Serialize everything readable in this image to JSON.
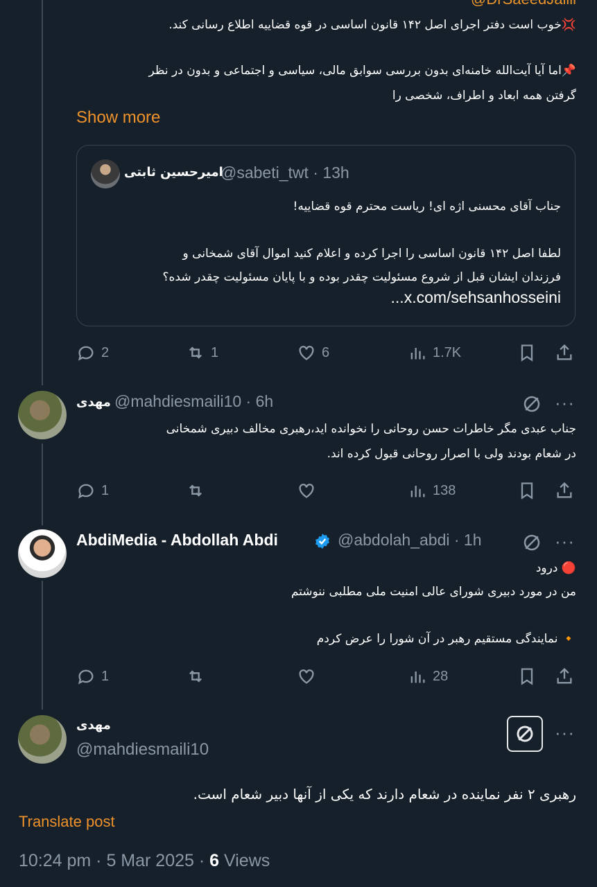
{
  "top": {
    "handle_partial": "@DrSaeedJalili",
    "line1": "💢خوب است دفتر اجرای اصل ۱۴۲ قانون اساسی در قوه قضاییه اطلاع رسانی کند.",
    "line2": "📌اما آیا آیت‌الله خامنه‌ای بدون بررسی سوابق مالی، سیاسی و اجتماعی و بدون در نظر",
    "line3": "گرفتن همه ابعاد و اطراف، شخصی را",
    "show_more": "Show more",
    "quote": {
      "name": "امیرحسین ثابتی",
      "handle": "@sabeti_twt",
      "time": "· 13h",
      "line1": "جناب آقای محسنی اژه ای! ریاست محترم قوه قضاییه!",
      "line2": "لطفا اصل ۱۴۲ قانون اساسی را اجرا کرده و اعلام کنید اموال آقای شمخانی و",
      "line3": "فرزندان ایشان قبل از شروع مسئولیت چقدر بوده و با پایان مسئولیت چقدر شده؟",
      "line4": "x.com/sehsanhosseini..."
    },
    "actions": {
      "replies": "2",
      "reposts": "1",
      "likes": "6",
      "views": "1.7K"
    }
  },
  "reply1": {
    "name": "مهدی",
    "handle": "@mahdiesmaili10",
    "time": "· 6h",
    "line1": "جناب عبدی مگر خاطرات حسن روحانی را نخوانده اید،رهبری مخالف دبیری شمخانی",
    "line2": "در شعام بودند ولی با اصرار روحانی قبول کرده اند.",
    "actions": {
      "replies": "1",
      "reposts": "",
      "likes": "",
      "views": "138"
    }
  },
  "reply2": {
    "name": "AbdiMedia - Abdollah Abdi",
    "handle": "@abdolah_abdi",
    "time": "· 1h",
    "line1": "🔴 درود",
    "line2": "من در مورد دبیری شورای عالی امنیت ملی مطلبی ننوشتم",
    "line3": "🔸 نمایندگی مستقیم رهبر در آن شورا را عرض کردم",
    "actions": {
      "replies": "1",
      "reposts": "",
      "likes": "",
      "views": "28"
    }
  },
  "main": {
    "name": "مهدی",
    "handle": "@mahdiesmaili10",
    "text": "رهبری ۲ نفر نماینده در شعام دارند که یکی از آنها دبیر شعام است.",
    "translate": "Translate post",
    "time": "10:24 pm · 5 Mar 2025 ·",
    "views_count": "6",
    "views_label": "Views"
  },
  "colors": {
    "background": "#15202b",
    "accent": "#f0922b",
    "muted": "#8b98a5",
    "verified": "#1d9bf0"
  }
}
